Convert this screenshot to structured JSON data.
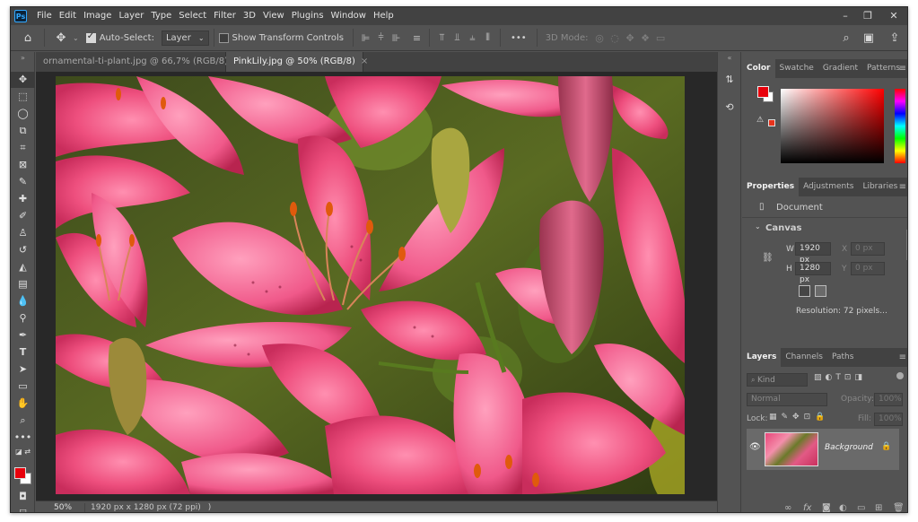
{
  "app": {
    "logo": "Ps"
  },
  "menu": [
    "File",
    "Edit",
    "Image",
    "Layer",
    "Type",
    "Select",
    "Filter",
    "3D",
    "View",
    "Plugins",
    "Window",
    "Help"
  ],
  "options_bar": {
    "auto_select_label": "Auto-Select:",
    "auto_select_checked": true,
    "target_value": "Layer",
    "transform_label": "Show Transform Controls",
    "more": "•••",
    "mode_label": "3D Mode:"
  },
  "tabs": [
    {
      "label": "ornamental-ti-plant.jpg @ 66,7% (RGB/8)",
      "close": "×",
      "active": false
    },
    {
      "label": "PinkLily.jpg @ 50% (RGB/8)",
      "close": "×",
      "active": true
    }
  ],
  "status": {
    "zoom": "50%",
    "info": "1920 px x 1280 px (72 ppi)",
    "arrow": ")"
  },
  "color_panel": {
    "tabs": [
      "Color",
      "Swatche",
      "Gradient",
      "Patterns"
    ],
    "foreground": "#e8000b",
    "background": "#ffffff",
    "warning_icon": "⚠"
  },
  "properties_panel": {
    "tabs": [
      "Properties",
      "Adjustments",
      "Libraries"
    ],
    "document_label": "Document",
    "canvas_label": "Canvas",
    "w_label": "W",
    "w_value": "1920 px",
    "h_label": "H",
    "h_value": "1280 px",
    "x_label": "X",
    "x_value": "0 px",
    "y_label": "Y",
    "y_value": "0 px",
    "resolution": "Resolution: 72 pixels..."
  },
  "layers_panel": {
    "tabs": [
      "Layers",
      "Channels",
      "Paths"
    ],
    "kind_label": "Kind",
    "blend_mode": "Normal",
    "opacity_label": "Opacity:",
    "opacity_value": "100%",
    "lock_label": "Lock:",
    "fill_label": "Fill:",
    "fill_value": "100%",
    "layer_name": "Background",
    "footer_fx": "fx"
  },
  "colors": {
    "accent": "#31a8ff",
    "brand_bg": "#0c2339"
  }
}
